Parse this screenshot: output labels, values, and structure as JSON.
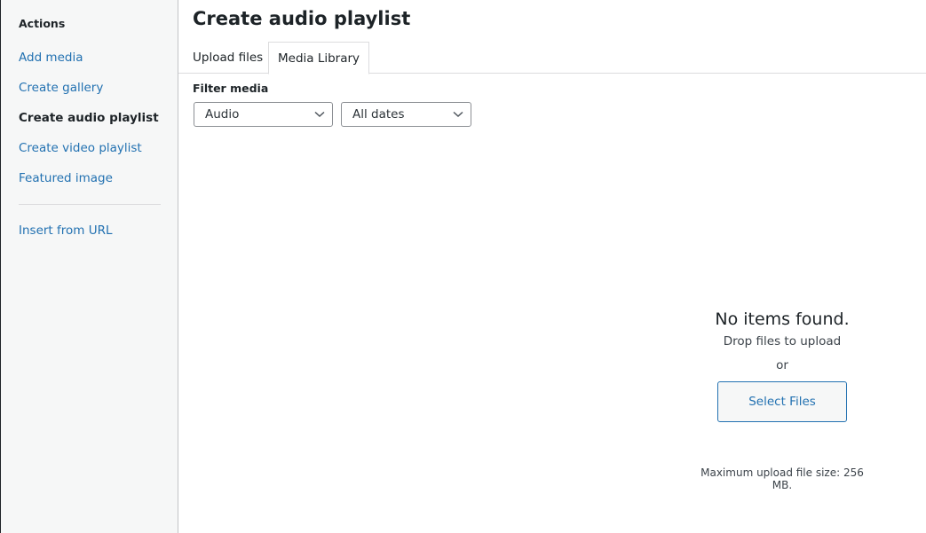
{
  "sidebar": {
    "heading": "Actions",
    "items": [
      {
        "label": "Add media",
        "active": false
      },
      {
        "label": "Create gallery",
        "active": false
      },
      {
        "label": "Create audio playlist",
        "active": true
      },
      {
        "label": "Create video playlist",
        "active": false
      },
      {
        "label": "Featured image",
        "active": false
      }
    ],
    "secondary_items": [
      {
        "label": "Insert from URL"
      }
    ]
  },
  "main": {
    "title": "Create audio playlist",
    "tabs": [
      {
        "label": "Upload files",
        "active": false
      },
      {
        "label": "Media Library",
        "active": true
      }
    ],
    "filter": {
      "label": "Filter media",
      "type_value": "Audio",
      "date_value": "All dates"
    },
    "empty_state": {
      "heading": "No items found.",
      "drop_text": "Drop files to upload",
      "or_text": "or",
      "button_label": "Select Files",
      "max_size_text": "Maximum upload file size: 256 MB."
    }
  },
  "colors": {
    "link": "#2271b1",
    "text": "#1d2327",
    "sidebar_bg": "#f6f7f7"
  }
}
